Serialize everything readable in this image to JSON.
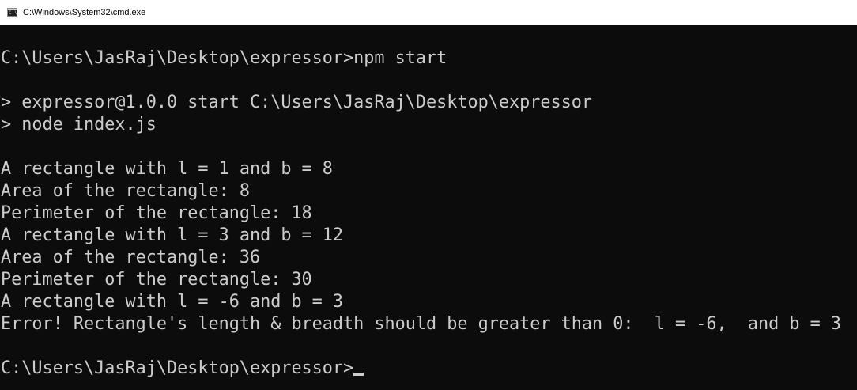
{
  "window": {
    "title": "C:\\Windows\\System32\\cmd.exe",
    "icon": "cmd-icon"
  },
  "console": {
    "lines": [
      "C:\\Users\\JasRaj\\Desktop\\expressor>npm start",
      "",
      "> expressor@1.0.0 start C:\\Users\\JasRaj\\Desktop\\expressor",
      "> node index.js",
      "",
      "A rectangle with l = 1 and b = 8",
      "Area of the rectangle: 8",
      "Perimeter of the rectangle: 18",
      "A rectangle with l = 3 and b = 12",
      "Area of the rectangle: 36",
      "Perimeter of the rectangle: 30",
      "A rectangle with l = -6 and b = 3",
      "Error! Rectangle's length & breadth should be greater than 0:  l = -6,  and b = 3",
      ""
    ],
    "prompt": "C:\\Users\\JasRaj\\Desktop\\expressor>",
    "colors": {
      "background": "#0c0c0c",
      "foreground": "#cccccc"
    }
  }
}
